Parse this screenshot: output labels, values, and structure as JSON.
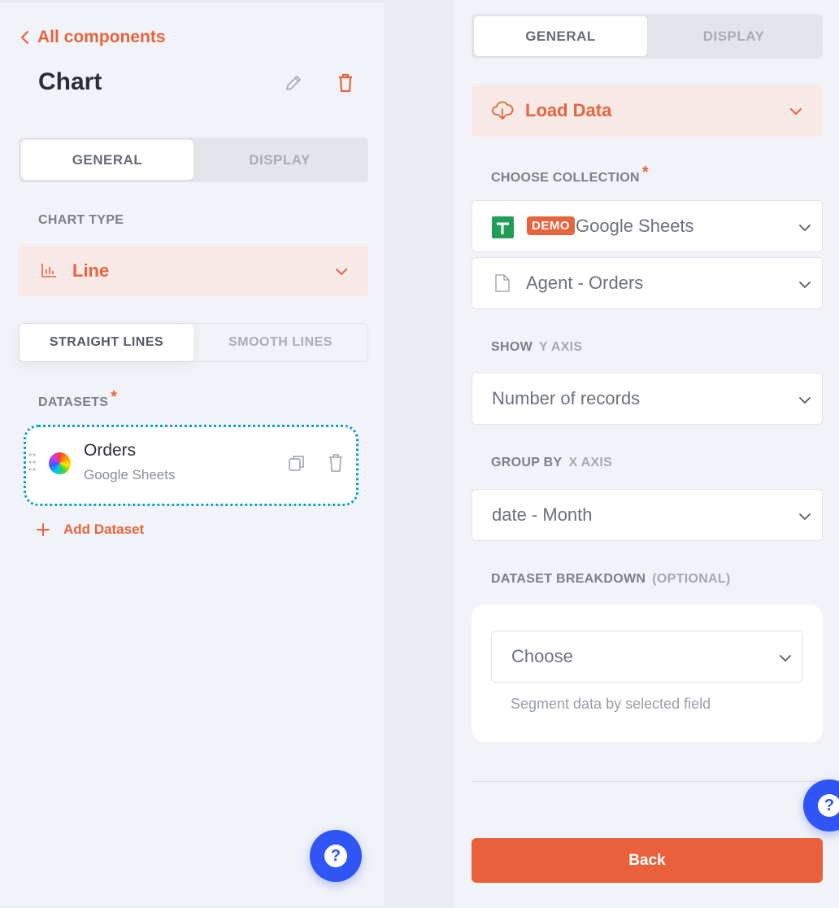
{
  "left": {
    "back_label": "All components",
    "title": "Chart",
    "tabs": [
      {
        "label": "GENERAL",
        "active": true
      },
      {
        "label": "DISPLAY",
        "active": false
      }
    ],
    "chart_type_label": "CHART TYPE",
    "chart_type_value": "Line",
    "line_style_options": [
      {
        "label": "STRAIGHT LINES",
        "active": true
      },
      {
        "label": "SMOOTH LINES",
        "active": false
      }
    ],
    "datasets_label": "DATASETS",
    "required_mark": "*",
    "datasets": [
      {
        "name": "Orders",
        "source": "Google Sheets"
      }
    ],
    "add_dataset_label": "Add Dataset"
  },
  "right": {
    "tabs": [
      {
        "label": "GENERAL",
        "active": true
      },
      {
        "label": "DISPLAY",
        "active": false
      }
    ],
    "load_data_label": "Load Data",
    "choose_collection_label": "CHOOSE COLLECTION",
    "required_mark": "*",
    "collection": {
      "badge": "DEMO",
      "value": "Google Sheets"
    },
    "sheet_value": "Agent - Orders",
    "show_label": "SHOW",
    "show_sub": "Y AXIS",
    "show_value": "Number of records",
    "group_by_label": "GROUP BY",
    "group_by_sub": "X AXIS",
    "group_by_value": "date - Month",
    "breakdown_label": "DATASET BREAKDOWN",
    "breakdown_sub": "(OPTIONAL)",
    "breakdown_placeholder": "Choose",
    "breakdown_hint": "Segment data by selected field",
    "back_button": "Back"
  },
  "help_label": "?",
  "colors": {
    "accent": "#e8643c",
    "help_blue": "#2f55f4",
    "focus_outline": "#0ea1cf",
    "sheets_green": "#1e9e57"
  }
}
